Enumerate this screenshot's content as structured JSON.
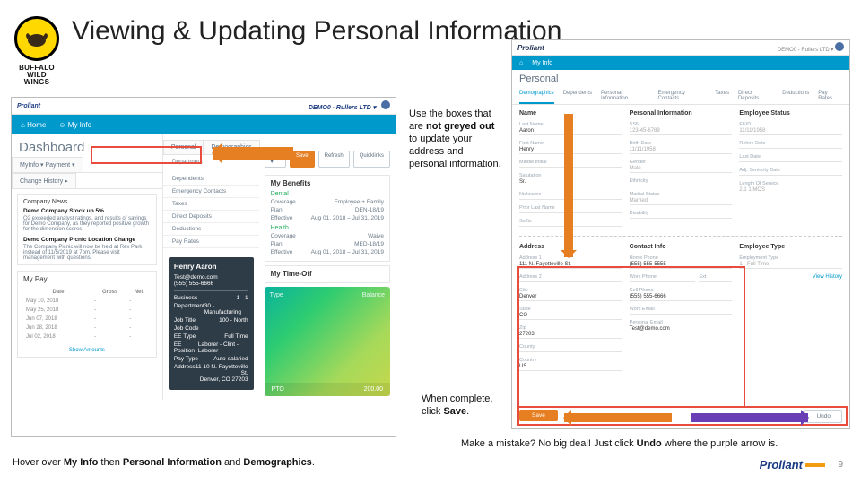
{
  "title": "Viewing & Updating Personal Information",
  "bww": {
    "l1": "BUFFALO",
    "l2": "WILD",
    "l3": "WINGS"
  },
  "brand": "Proliant",
  "header_right": "DEMO0 - Rullers LTD ▾",
  "nav": {
    "home": "Home",
    "myinfo": "My Info"
  },
  "dashboard": "Dashboard",
  "left_tabs": {
    "a": "MyInfo ▾ Payment ▾",
    "b": "Change History ▸"
  },
  "right_tabs": {
    "a": "Personal",
    "b": "Demographics"
  },
  "sidecol_header": "Department",
  "sidecol_items": [
    "Dependents",
    "Emergency Contacts",
    "Taxes",
    "Direct Deposits",
    "Deductions",
    "Pay Rates"
  ],
  "news": {
    "title": "Company News",
    "h1": "Demo Company Stock up 5%",
    "p1": "Q2 exceeded analyst ratings, and results of savings for Demo Company, as they reported positive growth for the dimension scores.",
    "h2": "Demo Company Picnic Location Change",
    "p2": "The Company Picnic will now be held at Rex Park instead of 11/5/2019 at 7pm. Please visit management with questions."
  },
  "info": {
    "name": "Henry Aaron",
    "email": "Test@demo.com",
    "phone": "(555) 555-6666",
    "rows": [
      [
        "Business",
        "1 - 1"
      ],
      [
        "Department",
        "30 - Manufacturing"
      ],
      [
        "Job Title",
        "100 - North"
      ],
      [
        "Job Code",
        ""
      ],
      [
        "EE Type",
        "Full Time"
      ],
      [
        "EE Position",
        "Laborer - Clint - Laborer"
      ],
      [
        "Pay Type",
        "Auto-salaried"
      ],
      [
        "Address",
        "11 10 N. Fayetteville St.\nDenver, CO 27203"
      ]
    ]
  },
  "pillrow": {
    "p1": "Edit ▾",
    "p2": "Save",
    "p3": "Refresh",
    "p4": "Quicklinks"
  },
  "benefits": {
    "title": "My Benefits",
    "d_head": "Dental",
    "rows_d": [
      [
        "Coverage",
        "Employee + Family"
      ],
      [
        "Plan",
        "DEN-18/19"
      ],
      [
        "Effective",
        "Aug 01, 2018 – Jul 31, 2019"
      ]
    ],
    "h_head": "Health",
    "rows_h": [
      [
        "Coverage",
        "Waive"
      ],
      [
        "Plan",
        "MED-18/19"
      ],
      [
        "Effective",
        "Aug 01, 2018 – Jul 31, 2019"
      ]
    ]
  },
  "timeoff": {
    "title": "My Time-Off",
    "type": "Type",
    "bal": "Balance",
    "r1": "PTO",
    "r2": "200.00"
  },
  "mypay": {
    "title": "My Pay",
    "cols": [
      "Date",
      "Gross",
      "Net"
    ],
    "rows": [
      "May 10, 2018",
      "May 25, 2018",
      "Jun 07, 2018",
      "Jun 28, 2018",
      "Jul 02, 2018"
    ],
    "show": "Show Amounts"
  },
  "callout1_a": "Use the boxes that are ",
  "callout1_b": "not greyed out",
  "callout1_c": " to update your address and personal information.",
  "callout2_a": "When complete, click ",
  "callout2_b": "Save",
  "callout3_a": "Make a mistake? No big deal! Just click ",
  "callout3_b": "Undo",
  "callout3_c": " where the purple arrow is.",
  "footnote_a": "Hover over ",
  "footnote_b": "My Info",
  "footnote_c": " then ",
  "footnote_d": "Personal Information",
  "footnote_e": " and ",
  "footnote_f": "Demographics",
  "page_num": "9",
  "personal": {
    "pageTitle": "Personal",
    "tabs": [
      "Demographics",
      "Dependents",
      "Personal Information",
      "Emergency Contacts",
      "Taxes",
      "Direct Deposits",
      "Deductions",
      "Pay Rates"
    ],
    "sections": {
      "name": "Name",
      "pi": "Personal Information",
      "es": "Employee Status"
    },
    "fields": {
      "ssn": {
        "label": "SSN",
        "val": "123-45-6789"
      },
      "eeid": {
        "label": "EEID",
        "val": "11/11/1958"
      },
      "lastname": {
        "label": "Last Name",
        "val": "Aaron"
      },
      "birthdate": {
        "label": "Birth Date",
        "val": "11/11/1958"
      },
      "rehire": {
        "label": "Rehire Date",
        "val": ""
      },
      "firstname": {
        "label": "First Name",
        "val": "Henry"
      },
      "gender": {
        "label": "Gender",
        "val": "Male"
      },
      "lastdate": {
        "label": "Last Date",
        "val": ""
      },
      "middle": {
        "label": "Middle Initial",
        "val": ""
      },
      "ethnicity": {
        "label": "Ethnicity",
        "val": ""
      },
      "adjsen": {
        "label": "Adj. Seniority Date",
        "val": ""
      },
      "salutation": {
        "label": "Salutation",
        "val": "Sr."
      },
      "marital": {
        "label": "Marital Status",
        "val": "Married"
      },
      "los": {
        "label": "Length Of Service",
        "val": "2.1    1 MOS"
      },
      "nickname": {
        "label": "Nickname",
        "val": ""
      },
      "disability": {
        "label": "Disability",
        "val": ""
      },
      "priorlast": {
        "label": "Prior Last Name",
        "val": ""
      },
      "suffix": {
        "label": "Suffix",
        "val": ""
      }
    },
    "lower_sections": {
      "addr": "Address",
      "contact": "Contact Info",
      "etype": "Employee Type"
    },
    "lower": {
      "addr1": {
        "label": "Address 1",
        "val": "111 N. Fayetteville St."
      },
      "addr2": {
        "label": "Address 2",
        "val": ""
      },
      "city": {
        "label": "City",
        "val": "Denver"
      },
      "state": {
        "label": "State",
        "val": "CO"
      },
      "zip": {
        "label": "Zip",
        "val": "27203"
      },
      "county": {
        "label": "County",
        "val": ""
      },
      "country": {
        "label": "Country",
        "val": "US"
      },
      "homeph": {
        "label": "Home Phone",
        "val": "(555) 555-5555"
      },
      "workph": {
        "label": "Work Phone",
        "val": ""
      },
      "ext": {
        "label": "Ext",
        "val": ""
      },
      "cellph": {
        "label": "Cell Phone",
        "val": "(555) 555-6666"
      },
      "workemail": {
        "label": "Work Email",
        "val": ""
      },
      "persemail": {
        "label": "Personal Email",
        "val": "Test@demo.com"
      },
      "emptype": {
        "label": "Employment Type",
        "val": "1 - Full Time"
      },
      "history": {
        "label": "View History"
      }
    },
    "save": "Save",
    "undo": "Undo"
  }
}
